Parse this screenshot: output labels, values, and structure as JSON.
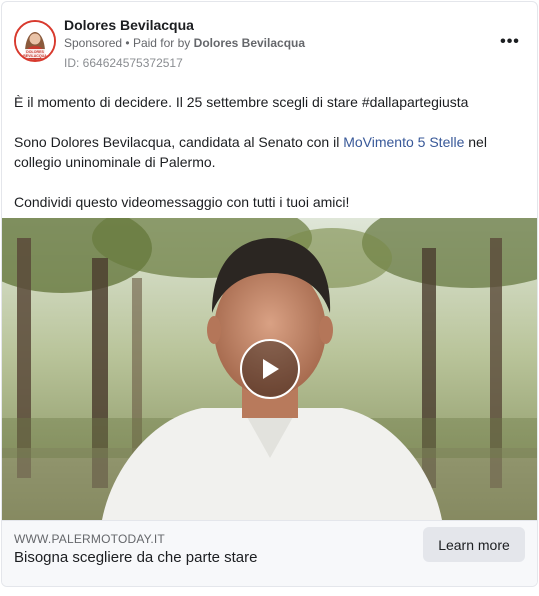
{
  "advertiser": {
    "name": "Dolores Bevilacqua",
    "sponsored_label": "Sponsored",
    "separator": "•",
    "paid_for_prefix": "Paid for by",
    "paid_for_name": "Dolores Bevilacqua",
    "ad_id": "ID: 664624575372517",
    "avatar_text_1": "DOLORES",
    "avatar_text_2": "BEVILACQUA"
  },
  "menu": {
    "more_icon": "more-horizontal-icon",
    "more_label": "•••"
  },
  "post": {
    "line_1": "È il momento di decidere. Il 25 settembre scegli di stare #dallapartegiusta",
    "line_2_before": "Sono Dolores Bevilacqua, candidata al Senato con il ",
    "line_2_link": "MoVimento 5 Stelle",
    "line_2_after": " nel collegio uninominale di Palermo.",
    "line_3": "Condividi questo videomessaggio con tutti i tuoi amici!"
  },
  "video": {
    "play_icon": "play-icon"
  },
  "link_preview": {
    "domain": "WWW.PALERMOTODAY.IT",
    "headline": "Bisogna scegliere da che parte stare",
    "cta_label": "Learn more"
  },
  "colors": {
    "link": "#385898",
    "secondary_text": "#65676b",
    "button_bg": "#e4e6eb",
    "avatar_ring": "#d83a2e"
  }
}
